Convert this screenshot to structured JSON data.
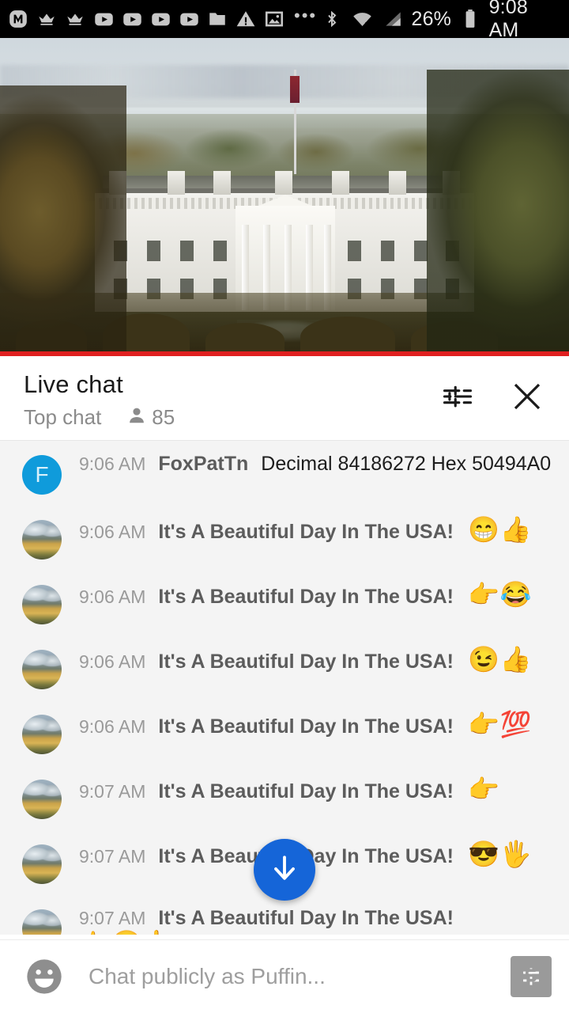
{
  "status_bar": {
    "icons": [
      "monogram-m-icon",
      "crown-icon",
      "crown-icon",
      "youtube-play-icon",
      "youtube-play-icon",
      "youtube-play-icon",
      "youtube-play-icon",
      "folder-icon",
      "warning-triangle-icon",
      "image-icon"
    ],
    "overflow_dots": "•••",
    "bluetooth_icon": "bluetooth-icon",
    "wifi_icon": "wifi-icon",
    "signal_icon": "cell-signal-icon",
    "battery_percent": "26%",
    "battery_icon": "battery-icon",
    "clock": "9:08 AM"
  },
  "video": {
    "alt": "White House live stream",
    "progress_color": "#e02020",
    "progress_percent": 100
  },
  "chat_header": {
    "title": "Live chat",
    "subtitle": "Top chat",
    "viewer_icon": "person-icon",
    "viewer_count": "85",
    "settings_icon": "tune-sliders-icon",
    "close_icon": "close-x-icon"
  },
  "messages": [
    {
      "avatar_type": "initial",
      "avatar_initial": "F",
      "avatar_color": "#0f9bdb",
      "time": "9:06 AM",
      "author": "FoxPatTn",
      "text": "Decimal 84186272 Hex 50494A0",
      "emoji": ""
    },
    {
      "avatar_type": "photo",
      "avatar_initial": "",
      "avatar_color": "",
      "time": "9:06 AM",
      "author": "It's A Beautiful Day In The USA!",
      "text": "",
      "emoji": "😁👍"
    },
    {
      "avatar_type": "photo",
      "avatar_initial": "",
      "avatar_color": "",
      "time": "9:06 AM",
      "author": "It's A Beautiful Day In The USA!",
      "text": "",
      "emoji": "👉😂"
    },
    {
      "avatar_type": "photo",
      "avatar_initial": "",
      "avatar_color": "",
      "time": "9:06 AM",
      "author": "It's A Beautiful Day In The USA!",
      "text": "",
      "emoji": "😉👍"
    },
    {
      "avatar_type": "photo",
      "avatar_initial": "",
      "avatar_color": "",
      "time": "9:06 AM",
      "author": "It's A Beautiful Day In The USA!",
      "text": "",
      "emoji": "👉💯"
    },
    {
      "avatar_type": "photo",
      "avatar_initial": "",
      "avatar_color": "",
      "time": "9:07 AM",
      "author": "It's A Beautiful Day In The USA!",
      "text": "",
      "emoji": "👉"
    },
    {
      "avatar_type": "photo",
      "avatar_initial": "",
      "avatar_color": "",
      "time": "9:07 AM",
      "author": "It's A Beautiful Day In The USA!",
      "text": "",
      "emoji": "😎🖐"
    },
    {
      "avatar_type": "photo",
      "avatar_initial": "",
      "avatar_color": "",
      "time": "9:07 AM",
      "author": "It's A Beautiful Day In The USA!",
      "text": "",
      "emoji": "👉😀👆"
    }
  ],
  "scroll_button": {
    "icon": "arrow-down-icon",
    "color": "#1565d8"
  },
  "composer": {
    "emoji_icon": "emoji-face-icon",
    "placeholder": "Chat publicly as Puffin...",
    "value": "",
    "super_chat_icon": "super-chat-dollar-icon"
  }
}
